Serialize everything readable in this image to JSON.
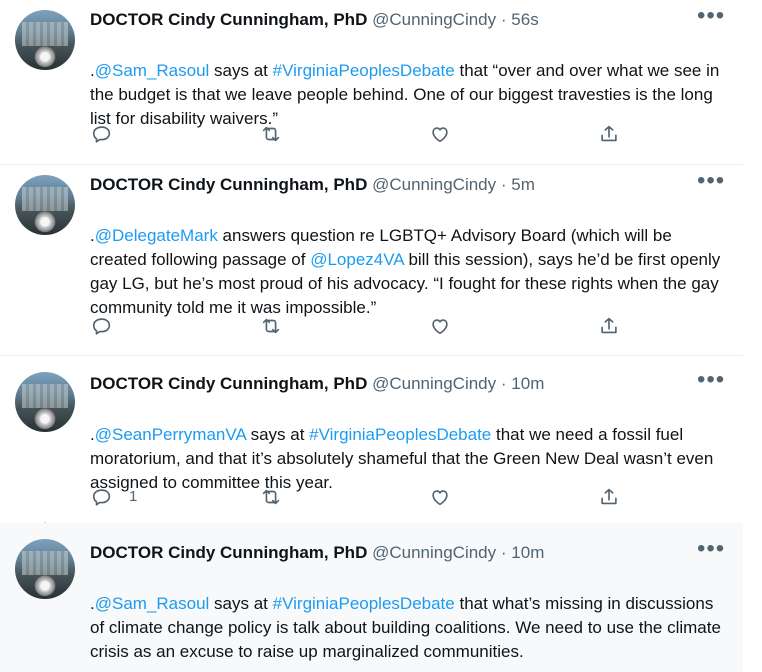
{
  "tweets": [
    {
      "author": "DOCTOR Cindy Cunningham, PhD",
      "handle": "@CunningCindy",
      "time": "56s",
      "text_parts": [
        {
          "t": ".",
          "link": false
        },
        {
          "t": "@Sam_Rasoul",
          "link": true
        },
        {
          "t": " says at ",
          "link": false
        },
        {
          "t": "#VirginiaPeoplesDebate",
          "link": true
        },
        {
          "t": " that “over and over what we see in the budget is that we leave people behind. One of our biggest travesties is the long list for disability waivers.”",
          "link": false
        }
      ],
      "reply_count": ""
    },
    {
      "author": "DOCTOR Cindy Cunningham, PhD",
      "handle": "@CunningCindy",
      "time": "5m",
      "text_parts": [
        {
          "t": ".",
          "link": false
        },
        {
          "t": "@DelegateMark",
          "link": true
        },
        {
          "t": " answers question re LGBTQ+ Advisory Board (which will be created following passage of  ",
          "link": false
        },
        {
          "t": "@Lopez4VA",
          "link": true
        },
        {
          "t": " bill this session), says he’d be first openly gay LG, but he’s most proud of his advocacy. “I fought for these rights when the gay community told me it was impossible.”",
          "link": false
        }
      ],
      "reply_count": ""
    },
    {
      "author": "DOCTOR Cindy Cunningham, PhD",
      "handle": "@CunningCindy",
      "time": "10m",
      "text_parts": [
        {
          "t": ".",
          "link": false
        },
        {
          "t": "@SeanPerrymanVA",
          "link": true
        },
        {
          "t": " says at ",
          "link": false
        },
        {
          "t": "#VirginiaPeoplesDebate",
          "link": true
        },
        {
          "t": " that we need a fossil fuel moratorium, and that it’s absolutely shameful that the Green New Deal wasn’t even assigned to  committee this year.",
          "link": false
        }
      ],
      "reply_count": "1"
    },
    {
      "author": "DOCTOR Cindy Cunningham, PhD",
      "handle": "@CunningCindy",
      "time": "10m",
      "text_parts": [
        {
          "t": ".",
          "link": false
        },
        {
          "t": "@Sam_Rasoul",
          "link": true
        },
        {
          "t": " says at ",
          "link": false
        },
        {
          "t": "#VirginiaPeoplesDebate",
          "link": true
        },
        {
          "t": " that what’s missing in discussions of climate change policy is talk about building coalitions. We need to use the climate crisis as an excuse to raise up marginalized communities.",
          "link": false
        }
      ],
      "reply_count": ""
    }
  ],
  "separator": "·",
  "colors": {
    "link": "#1d9bf0",
    "secondary": "#536471",
    "border": "#e6ecf0"
  },
  "icons": [
    "reply-icon",
    "retweet-icon",
    "like-icon",
    "share-icon",
    "more-icon",
    "avatar"
  ]
}
